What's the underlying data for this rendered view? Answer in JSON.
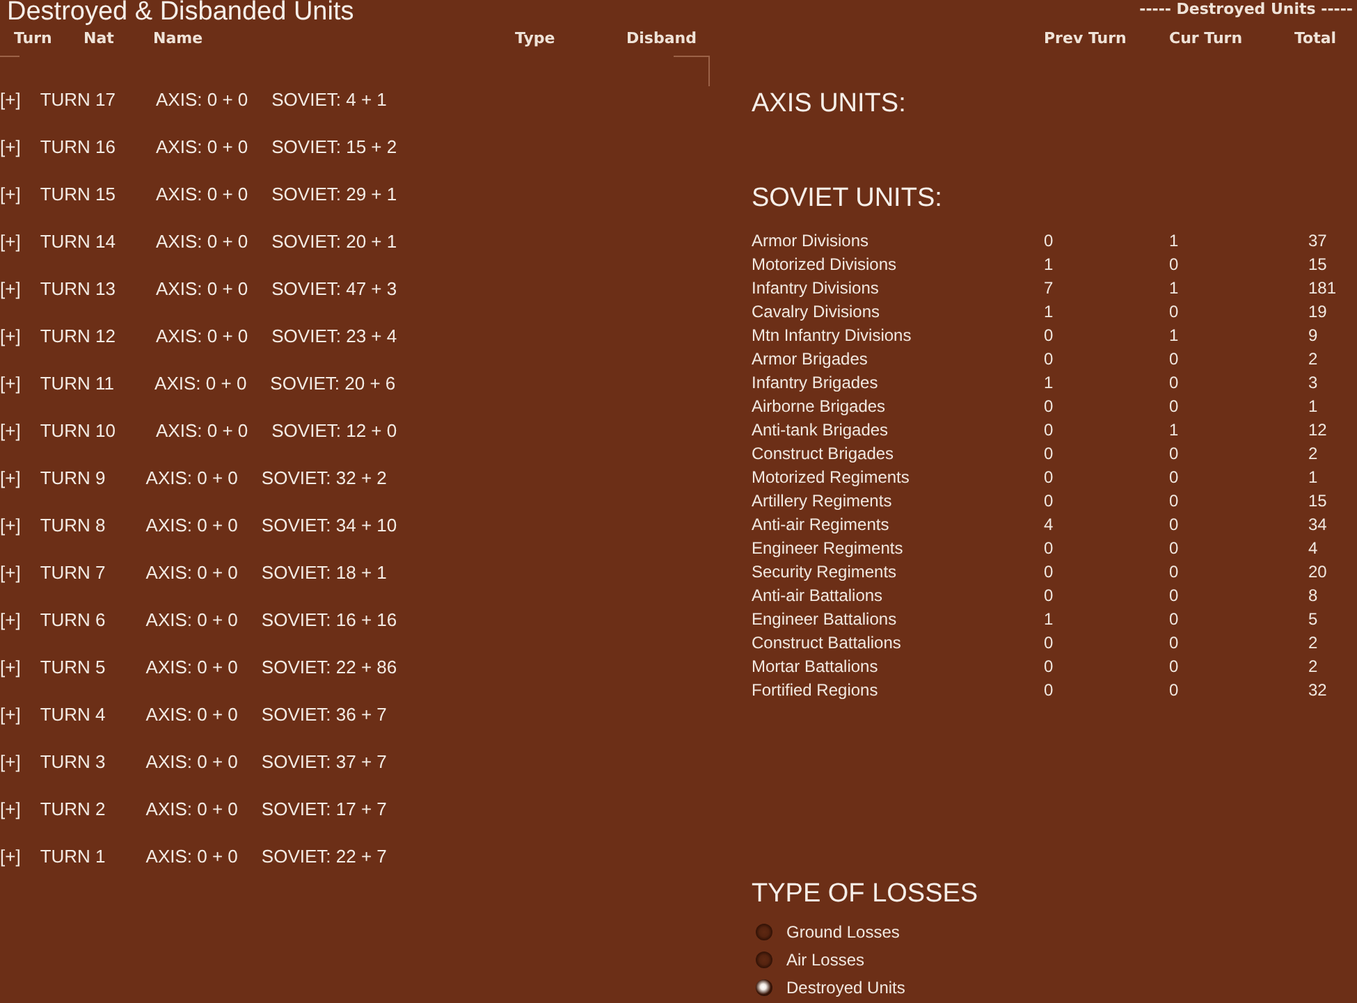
{
  "window": {
    "title": "Destroyed & Disbanded Units"
  },
  "turn_list": {
    "columns": [
      "Turn",
      "Nat",
      "Name",
      "Type",
      "Disband"
    ],
    "rows": [
      {
        "toggle": "[+]",
        "turn": "TURN 17",
        "axis": "AXIS: 0 + 0",
        "soviet": "SOVIET: 4 + 1"
      },
      {
        "toggle": "[+]",
        "turn": "TURN 16",
        "axis": "AXIS: 0 + 0",
        "soviet": "SOVIET: 15 + 2"
      },
      {
        "toggle": "[+]",
        "turn": "TURN 15",
        "axis": "AXIS: 0 + 0",
        "soviet": "SOVIET: 29 + 1"
      },
      {
        "toggle": "[+]",
        "turn": "TURN 14",
        "axis": "AXIS: 0 + 0",
        "soviet": "SOVIET: 20 + 1"
      },
      {
        "toggle": "[+]",
        "turn": "TURN 13",
        "axis": "AXIS: 0 + 0",
        "soviet": "SOVIET: 47 + 3"
      },
      {
        "toggle": "[+]",
        "turn": "TURN 12",
        "axis": "AXIS: 0 + 0",
        "soviet": "SOVIET: 23 + 4"
      },
      {
        "toggle": "[+]",
        "turn": "TURN 11",
        "axis": "AXIS: 0 + 0",
        "soviet": "SOVIET: 20 + 6"
      },
      {
        "toggle": "[+]",
        "turn": "TURN 10",
        "axis": "AXIS: 0 + 0",
        "soviet": "SOVIET: 12 + 0"
      },
      {
        "toggle": "[+]",
        "turn": "TURN 9",
        "axis": "AXIS: 0 + 0",
        "soviet": "SOVIET: 32 + 2"
      },
      {
        "toggle": "[+]",
        "turn": "TURN 8",
        "axis": "AXIS: 0 + 0",
        "soviet": "SOVIET: 34 + 10"
      },
      {
        "toggle": "[+]",
        "turn": "TURN 7",
        "axis": "AXIS: 0 + 0",
        "soviet": "SOVIET: 18 + 1"
      },
      {
        "toggle": "[+]",
        "turn": "TURN 6",
        "axis": "AXIS: 0 + 0",
        "soviet": "SOVIET: 16 + 16"
      },
      {
        "toggle": "[+]",
        "turn": "TURN 5",
        "axis": "AXIS: 0 + 0",
        "soviet": "SOVIET: 22 + 86"
      },
      {
        "toggle": "[+]",
        "turn": "TURN 4",
        "axis": "AXIS: 0 + 0",
        "soviet": "SOVIET: 36 + 7"
      },
      {
        "toggle": "[+]",
        "turn": "TURN 3",
        "axis": "AXIS: 0 + 0",
        "soviet": "SOVIET: 37 + 7"
      },
      {
        "toggle": "[+]",
        "turn": "TURN 2",
        "axis": "AXIS: 0 + 0",
        "soviet": "SOVIET: 17 + 7"
      },
      {
        "toggle": "[+]",
        "turn": "TURN 1",
        "axis": "AXIS: 0 + 0",
        "soviet": "SOVIET: 22 + 7"
      }
    ]
  },
  "summary": {
    "banner": "----- Destroyed Units -----",
    "columns": [
      "Prev Turn",
      "Cur Turn",
      "Total"
    ],
    "sections": [
      {
        "title": "AXIS UNITS:"
      },
      {
        "title": "SOVIET UNITS:",
        "rows": [
          {
            "name": "Armor Divisions",
            "prev_turn": "0",
            "cur_turn": "1",
            "total": "37"
          },
          {
            "name": "Motorized Divisions",
            "prev_turn": "1",
            "cur_turn": "0",
            "total": "15"
          },
          {
            "name": "Infantry Divisions",
            "prev_turn": "7",
            "cur_turn": "1",
            "total": "181"
          },
          {
            "name": "Cavalry Divisions",
            "prev_turn": "1",
            "cur_turn": "0",
            "total": "19"
          },
          {
            "name": "Mtn Infantry Divisions",
            "prev_turn": "0",
            "cur_turn": "1",
            "total": "9"
          },
          {
            "name": "Armor Brigades",
            "prev_turn": "0",
            "cur_turn": "0",
            "total": "2"
          },
          {
            "name": "Infantry Brigades",
            "prev_turn": "1",
            "cur_turn": "0",
            "total": "3"
          },
          {
            "name": "Airborne Brigades",
            "prev_turn": "0",
            "cur_turn": "0",
            "total": "1"
          },
          {
            "name": "Anti-tank Brigades",
            "prev_turn": "0",
            "cur_turn": "1",
            "total": "12"
          },
          {
            "name": "Construct Brigades",
            "prev_turn": "0",
            "cur_turn": "0",
            "total": "2"
          },
          {
            "name": "Motorized Regiments",
            "prev_turn": "0",
            "cur_turn": "0",
            "total": "1"
          },
          {
            "name": "Artillery Regiments",
            "prev_turn": "0",
            "cur_turn": "0",
            "total": "15"
          },
          {
            "name": "Anti-air Regiments",
            "prev_turn": "4",
            "cur_turn": "0",
            "total": "34"
          },
          {
            "name": "Engineer Regiments",
            "prev_turn": "0",
            "cur_turn": "0",
            "total": "4"
          },
          {
            "name": "Security Regiments",
            "prev_turn": "0",
            "cur_turn": "0",
            "total": "20"
          },
          {
            "name": "Anti-air Battalions",
            "prev_turn": "0",
            "cur_turn": "0",
            "total": "8"
          },
          {
            "name": "Engineer Battalions",
            "prev_turn": "1",
            "cur_turn": "0",
            "total": "5"
          },
          {
            "name": "Construct Battalions",
            "prev_turn": "0",
            "cur_turn": "0",
            "total": "2"
          },
          {
            "name": "Mortar Battalions",
            "prev_turn": "0",
            "cur_turn": "0",
            "total": "2"
          },
          {
            "name": "Fortified Regions",
            "prev_turn": "0",
            "cur_turn": "0",
            "total": "32"
          }
        ]
      }
    ]
  },
  "loss_types": {
    "title": "TYPE OF LOSSES",
    "options": [
      {
        "label": "Ground Losses",
        "selected": false
      },
      {
        "label": "Air Losses",
        "selected": false
      },
      {
        "label": "Destroyed Units",
        "selected": true
      }
    ]
  }
}
